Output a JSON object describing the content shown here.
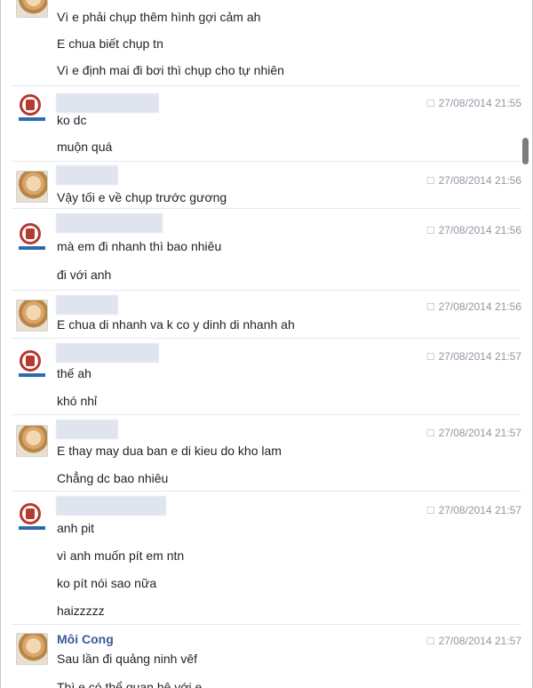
{
  "first_group": {
    "lines": [
      "Vì e phải chụp thêm hình gợi cảm ah",
      "E chua biết chụp tn",
      "Vì e định mai đi bơi thì chụp cho tự nhiên"
    ]
  },
  "messages": [
    {
      "avatar": "logo-avatar",
      "time": "27/08/2014 21:55",
      "lines": [
        "ko dc",
        "muộn quá"
      ]
    },
    {
      "avatar": "photo-avatar",
      "time": "27/08/2014 21:56",
      "lines": [
        "Vậy tối e về chụp trước gương"
      ]
    },
    {
      "avatar": "logo-avatar",
      "time": "27/08/2014 21:56",
      "lines": [
        "mà em đi nhanh thì bao nhiêu",
        "đi với anh"
      ]
    },
    {
      "avatar": "photo-avatar",
      "time": "27/08/2014 21:56",
      "lines": [
        "E chua di nhanh va k co y dinh di nhanh ah"
      ]
    },
    {
      "avatar": "logo-avatar",
      "time": "27/08/2014 21:57",
      "lines": [
        "thế ah",
        "khó nhỉ"
      ]
    },
    {
      "avatar": "photo-avatar",
      "time": "27/08/2014 21:57",
      "lines": [
        "E thay may dua ban e di kieu do kho lam",
        "Chẳng dc bao nhiêu"
      ]
    },
    {
      "avatar": "logo-avatar",
      "time": "27/08/2014 21:57",
      "lines": [
        "anh pit",
        "vì anh muốn pít em ntn",
        "ko pít nói sao nữa",
        "haizzzzz"
      ]
    },
    {
      "avatar": "photo-avatar",
      "name": "Môi Cong",
      "time": "27/08/2014 21:57",
      "lines": [
        "Sau lần đi quảng ninh vêf"
      ]
    }
  ]
}
